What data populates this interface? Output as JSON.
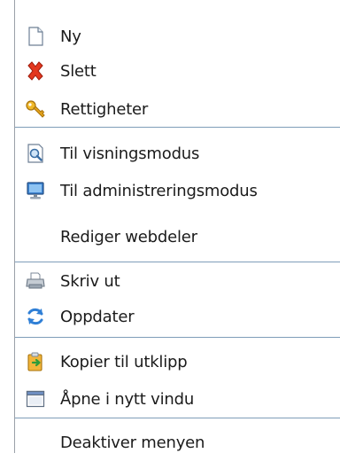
{
  "menu": {
    "items": {
      "new": {
        "label": "Ny",
        "icon": "new-document-icon"
      },
      "delete": {
        "label": "Slett",
        "icon": "delete-x-icon"
      },
      "permissions": {
        "label": "Rettigheter",
        "icon": "key-icon"
      },
      "view_mode": {
        "label": "Til visningsmodus",
        "icon": "view-mode-icon"
      },
      "admin_mode": {
        "label": "Til administreringsmodus",
        "icon": "admin-monitor-icon"
      },
      "edit_webparts": {
        "label": "Rediger webdeler"
      },
      "print": {
        "label": "Skriv ut",
        "icon": "printer-icon"
      },
      "refresh": {
        "label": "Oppdater",
        "icon": "refresh-icon"
      },
      "copy_clipboard": {
        "label": "Kopier til utklipp",
        "icon": "clipboard-icon"
      },
      "open_new_window": {
        "label": "Åpne i nytt vindu",
        "icon": "new-window-icon"
      },
      "disable_menu": {
        "label": "Deaktiver menyen"
      }
    }
  },
  "colors": {
    "separator": "#7f9db9",
    "text": "#1b1b1b",
    "delete_red": "#e3371e",
    "key_gold": "#e3a21a",
    "refresh_blue": "#2f7fd6"
  }
}
